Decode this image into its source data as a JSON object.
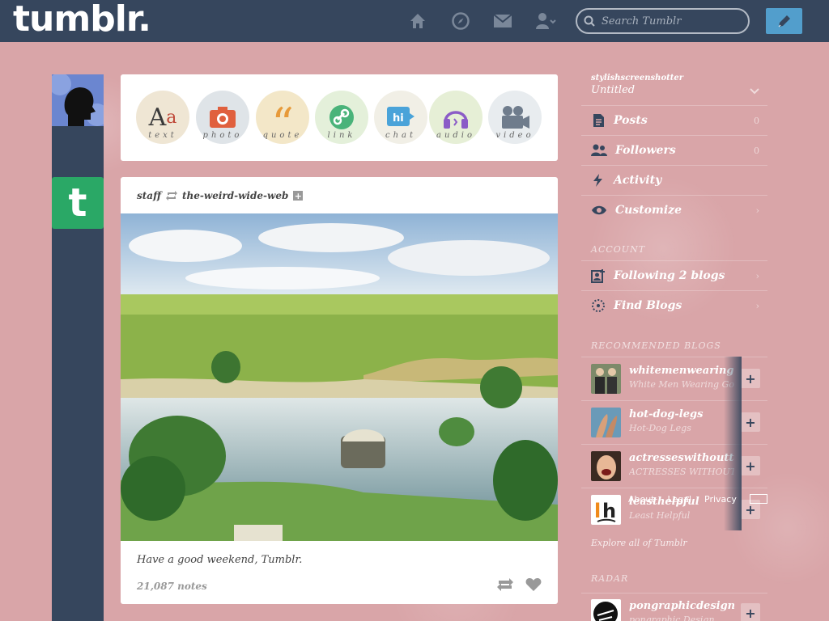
{
  "header": {
    "logo": "tumblr.",
    "search_placeholder": "Search Tumblr"
  },
  "post_types": [
    {
      "label": "text",
      "color": "#c04a3a"
    },
    {
      "label": "photo",
      "color": "#e0603e"
    },
    {
      "label": "quote",
      "color": "#e79a3a"
    },
    {
      "label": "link",
      "color": "#4ab37a"
    },
    {
      "label": "chat",
      "color": "#4aa3d9"
    },
    {
      "label": "audio",
      "color": "#8b5cc7"
    },
    {
      "label": "video",
      "color": "#6f7c8c"
    }
  ],
  "post": {
    "author": "staff",
    "reblogged_from": "the-weird-wide-web",
    "caption": "Have a good weekend, Tumblr.",
    "notes": "21,087 notes"
  },
  "sidebar": {
    "blog_name": "stylishscreenshotter",
    "blog_title": "Untitled",
    "items": [
      {
        "label": "Posts",
        "count": "0"
      },
      {
        "label": "Followers",
        "count": "0"
      },
      {
        "label": "Activity",
        "count": ""
      },
      {
        "label": "Customize",
        "count": ""
      }
    ],
    "account_title": "ACCOUNT",
    "account_items": [
      {
        "label": "Following 2 blogs"
      },
      {
        "label": "Find Blogs"
      }
    ],
    "recommended_title": "RECOMMENDED BLOGS",
    "recommended": [
      {
        "name": "whitemenwearinggoogle",
        "subtitle": "White Men Wearing Go..."
      },
      {
        "name": "hot-dog-legs",
        "subtitle": "Hot-Dog Legs"
      },
      {
        "name": "actresseswithoutteeth",
        "subtitle": "ACTRESSES WITHOUT..."
      },
      {
        "name": "leasthelpful",
        "subtitle": "Least Helpful"
      }
    ],
    "explore": "Explore all of Tumblr",
    "radar_title": "RADAR",
    "radar": {
      "name": "pongraphicdesign",
      "subtitle": "pongraphic Design"
    },
    "footer": {
      "about": "About",
      "legal": "Legal",
      "privacy": "Privacy"
    }
  }
}
